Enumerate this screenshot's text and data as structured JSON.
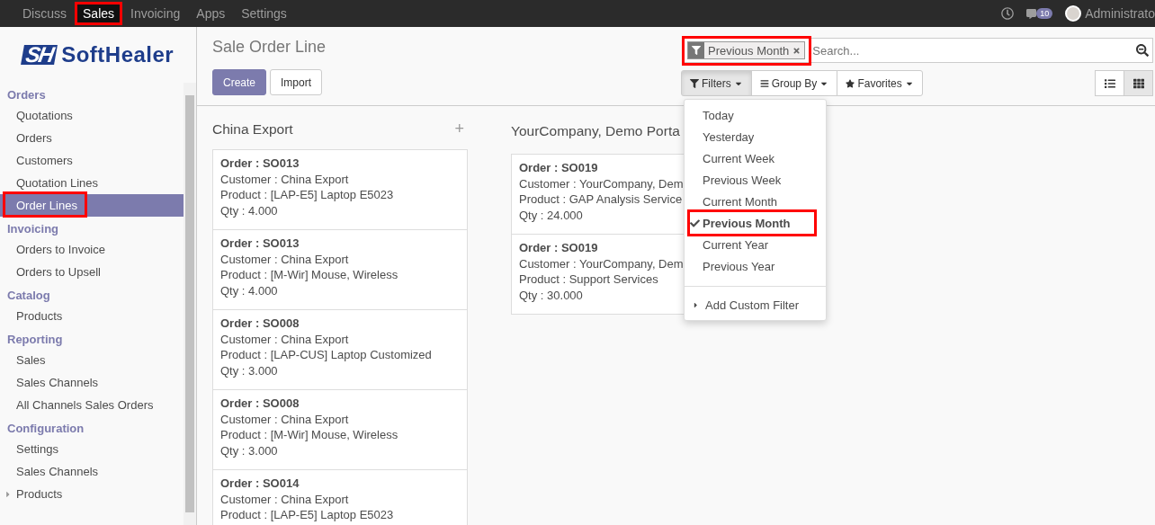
{
  "top_menu": [
    {
      "label": "Discuss",
      "selected": false,
      "highlighted": false
    },
    {
      "label": "Sales",
      "selected": true,
      "highlighted": true
    },
    {
      "label": "Invoicing",
      "selected": false,
      "highlighted": false
    },
    {
      "label": "Apps",
      "selected": false,
      "highlighted": false
    },
    {
      "label": "Settings",
      "selected": false,
      "highlighted": false
    }
  ],
  "messages_badge": "10",
  "user": "Administrato",
  "logo": {
    "mark": "SH",
    "name": "SoftHealer"
  },
  "sidebar": [
    {
      "title": "Orders",
      "items": [
        {
          "label": "Quotations",
          "selected": false,
          "highlighted": false
        },
        {
          "label": "Orders",
          "selected": false,
          "highlighted": false
        },
        {
          "label": "Customers",
          "selected": false,
          "highlighted": false
        },
        {
          "label": "Quotation Lines",
          "selected": false,
          "highlighted": false
        },
        {
          "label": "Order Lines",
          "selected": true,
          "highlighted": true
        }
      ]
    },
    {
      "title": "Invoicing",
      "items": [
        {
          "label": "Orders to Invoice",
          "selected": false,
          "highlighted": false
        },
        {
          "label": "Orders to Upsell",
          "selected": false,
          "highlighted": false
        }
      ]
    },
    {
      "title": "Catalog",
      "items": [
        {
          "label": "Products",
          "selected": false,
          "highlighted": false
        }
      ]
    },
    {
      "title": "Reporting",
      "items": [
        {
          "label": "Sales",
          "selected": false,
          "highlighted": false
        },
        {
          "label": "Sales Channels",
          "selected": false,
          "highlighted": false
        },
        {
          "label": "All Channels Sales Orders",
          "selected": false,
          "highlighted": false
        }
      ]
    },
    {
      "title": "Configuration",
      "items": [
        {
          "label": "Settings",
          "selected": false,
          "highlighted": false
        },
        {
          "label": "Sales Channels",
          "selected": false,
          "highlighted": false
        },
        {
          "label": "Products",
          "selected": false,
          "highlighted": false,
          "expanded": false
        }
      ]
    }
  ],
  "page_title": "Sale Order Line",
  "buttons": {
    "create": "Create",
    "import": "Import"
  },
  "search": {
    "facet": "Previous Month",
    "facet_highlighted": true,
    "placeholder": "Search..."
  },
  "search_buttons": [
    {
      "kind": "filters",
      "label": "Filters",
      "selected": true
    },
    {
      "kind": "groupby",
      "label": "Group By",
      "selected": false
    },
    {
      "kind": "favorites",
      "label": "Favorites",
      "selected": false
    }
  ],
  "views": [
    {
      "kind": "list",
      "selected": false
    },
    {
      "kind": "kanban",
      "selected": true
    }
  ],
  "filters_menu": {
    "items": [
      {
        "label": "Today",
        "checked": false,
        "highlighted": false
      },
      {
        "label": "Yesterday",
        "checked": false,
        "highlighted": false
      },
      {
        "label": "Current Week",
        "checked": false,
        "highlighted": false
      },
      {
        "label": "Previous Week",
        "checked": false,
        "highlighted": false
      },
      {
        "label": "Current Month",
        "checked": false,
        "highlighted": false
      },
      {
        "label": "Previous Month",
        "checked": true,
        "highlighted": true
      },
      {
        "label": "Current Year",
        "checked": false,
        "highlighted": false
      },
      {
        "label": "Previous Year",
        "checked": false,
        "highlighted": false
      }
    ],
    "custom": "Add Custom Filter"
  },
  "columns": [
    {
      "title": "China Export",
      "add": "+",
      "cards": [
        {
          "order": "Order : SO013",
          "lines": [
            "Customer : China Export",
            "Product : [LAP-E5] Laptop E5023",
            "Qty : 4.000"
          ]
        },
        {
          "order": "Order : SO013",
          "lines": [
            "Customer : China Export",
            "Product : [M-Wir] Mouse, Wireless",
            "Qty : 4.000"
          ]
        },
        {
          "order": "Order : SO008",
          "lines": [
            "Customer : China Export",
            "Product : [LAP-CUS] Laptop Customized",
            "Qty : 3.000"
          ]
        },
        {
          "order": "Order : SO008",
          "lines": [
            "Customer : China Export",
            "Product : [M-Wir] Mouse, Wireless",
            "Qty : 3.000"
          ]
        },
        {
          "order": "Order : SO014",
          "lines": [
            "Customer : China Export",
            "Product : [LAP-E5] Laptop E5023"
          ]
        }
      ]
    },
    {
      "title": "YourCompany, Demo Porta",
      "cards": [
        {
          "order": "Order : SO019",
          "lines": [
            "Customer : YourCompany, Dem",
            "Product : GAP Analysis Service",
            "Qty : 24.000"
          ]
        },
        {
          "order": "Order : SO019",
          "lines": [
            "Customer : YourCompany, Dem",
            "Product : Support Services",
            "Qty : 30.000"
          ]
        }
      ]
    }
  ]
}
